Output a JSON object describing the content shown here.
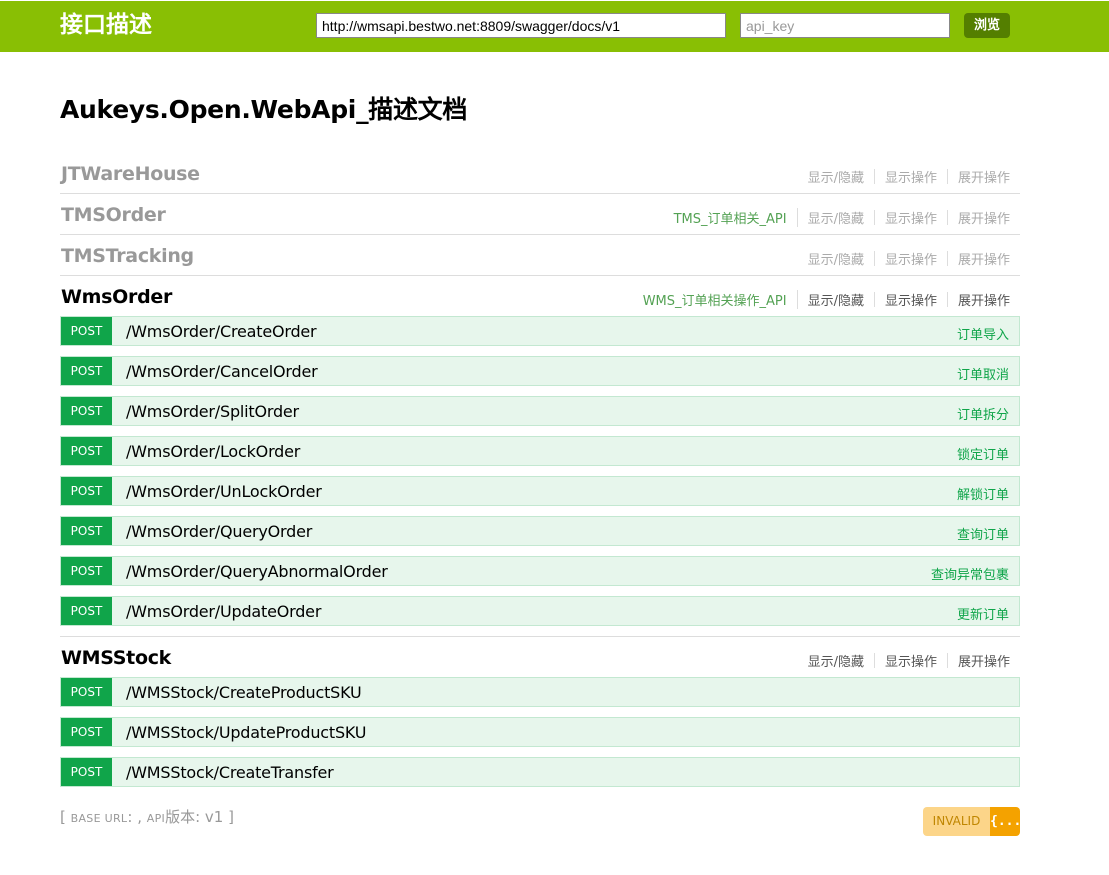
{
  "header": {
    "logo": "接口描述",
    "url_value": "http://wmsapi.bestwo.net:8809/swagger/docs/v1",
    "api_key_placeholder": "api_key",
    "explore_label": "浏览"
  },
  "doc_title": "Aukeys.Open.WebApi_描述文档",
  "resource_actions": {
    "toggle": "显示/隐藏",
    "list": "显示操作",
    "expand": "展开操作"
  },
  "resources": [
    {
      "name": "JTWareHouse",
      "description": ""
    },
    {
      "name": "TMSOrder",
      "description": "TMS_订单相关_API"
    },
    {
      "name": "TMSTracking",
      "description": ""
    },
    {
      "name": "WmsOrder",
      "description": "WMS_订单相关操作_API"
    },
    {
      "name": "WMSStock",
      "description": ""
    }
  ],
  "wms_order_operations": [
    {
      "method": "POST",
      "path": "/WmsOrder/CreateOrder",
      "summary": "订单导入"
    },
    {
      "method": "POST",
      "path": "/WmsOrder/CancelOrder",
      "summary": "订单取消"
    },
    {
      "method": "POST",
      "path": "/WmsOrder/SplitOrder",
      "summary": "订单拆分"
    },
    {
      "method": "POST",
      "path": "/WmsOrder/LockOrder",
      "summary": "锁定订单"
    },
    {
      "method": "POST",
      "path": "/WmsOrder/UnLockOrder",
      "summary": "解锁订单"
    },
    {
      "method": "POST",
      "path": "/WmsOrder/QueryOrder",
      "summary": "查询订单"
    },
    {
      "method": "POST",
      "path": "/WmsOrder/QueryAbnormalOrder",
      "summary": "查询异常包裹"
    },
    {
      "method": "POST",
      "path": "/WmsOrder/UpdateOrder",
      "summary": "更新订单"
    }
  ],
  "wms_stock_operations": [
    {
      "method": "POST",
      "path": "/WMSStock/CreateProductSKU",
      "summary": ""
    },
    {
      "method": "POST",
      "path": "/WMSStock/UpdateProductSKU",
      "summary": ""
    },
    {
      "method": "POST",
      "path": "/WMSStock/CreateTransfer",
      "summary": ""
    }
  ],
  "footer": {
    "open_bracket": "[",
    "base_url_label": "BASE URL",
    "base_url_rest": ": ,",
    "api_label": "API",
    "version_text": "版本: v1",
    "close_bracket": "]"
  },
  "validator": {
    "text": "INVALID",
    "icon_text": "{...}"
  },
  "colors": {
    "header": "#89bf04",
    "post_method": "#10a54a",
    "post_row": "#e7f6ec",
    "validator_text_bg": "#fcd589",
    "validator_icon_bg": "#f4a200"
  }
}
